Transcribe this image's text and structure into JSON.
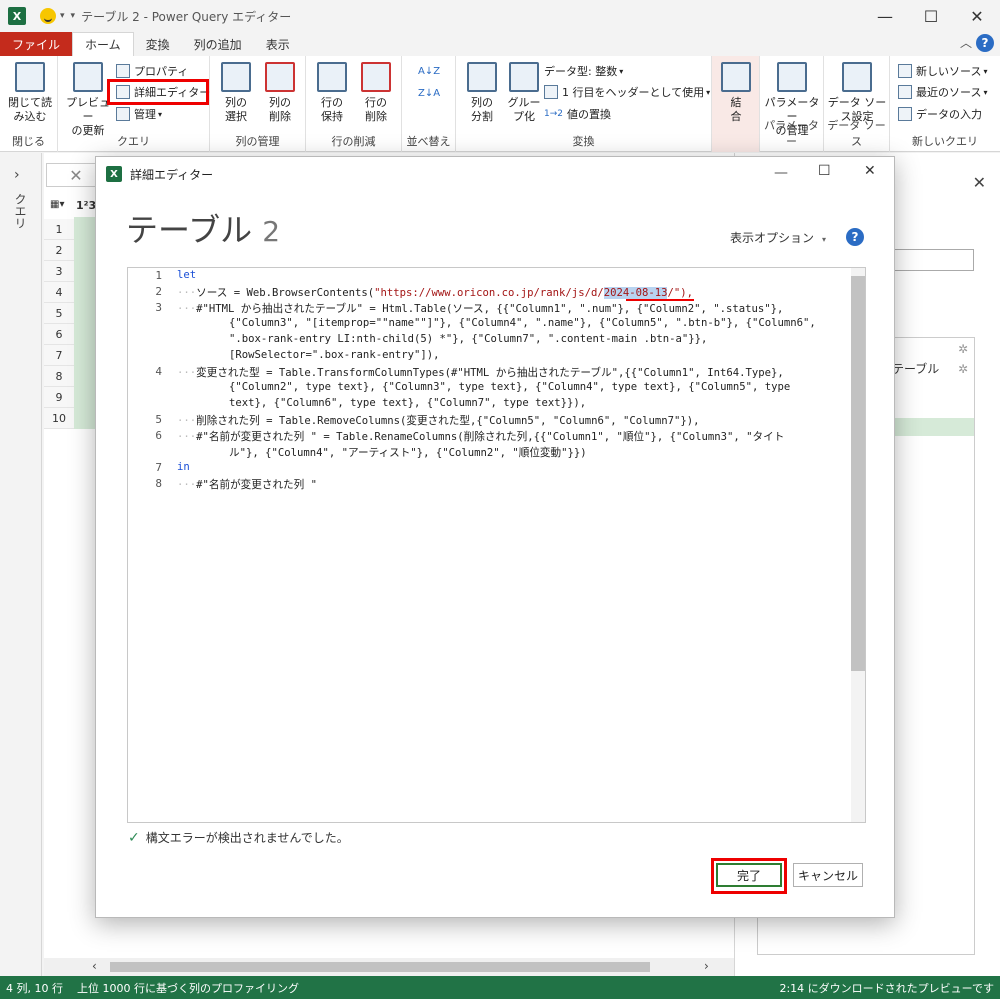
{
  "window": {
    "title": "テーブル 2 - Power Query エディター",
    "app_icon": "excel-icon"
  },
  "tabs": [
    "ファイル",
    "ホーム",
    "変換",
    "列の追加",
    "表示"
  ],
  "ribbon": {
    "close_group": {
      "btn": "閉じて読\nみ込む",
      "label": "閉じる"
    },
    "query_group": {
      "preview": "プレビュー\nの更新",
      "properties": "プロパティ",
      "advanced_editor": "詳細エディター",
      "manage": "管理",
      "label": "クエリ"
    },
    "columns_group": {
      "select": "列の\n選択",
      "remove": "列の\n削除",
      "label": "列の管理"
    },
    "rows_group": {
      "keep": "行の\n保持",
      "remove": "行の\n削除",
      "label": "行の削減"
    },
    "sort_group": {
      "label": "並べ替え"
    },
    "transform_group": {
      "split": "列の\n分割",
      "group": "グルー\nプ化",
      "datatype": "データ型: 整数",
      "header": "1 行目をヘッダーとして使用",
      "replace": "値の置換",
      "label": "変換"
    },
    "combine_group": {
      "btn": "結\n合",
      "label": ""
    },
    "param_group": {
      "btn": "パラメーター\nの管理",
      "label": "パラメーター"
    },
    "source_group": {
      "btn": "データ ソー\nス設定",
      "label": "データ ソース"
    },
    "newquery_group": {
      "new_source": "新しいソース",
      "recent": "最近のソース",
      "enter": "データの入力",
      "label": "新しいクエリ"
    }
  },
  "left_pane": {
    "label": "クエリ"
  },
  "grid": {
    "rows": [
      "1",
      "2",
      "3",
      "4",
      "5",
      "6",
      "7",
      "8",
      "9",
      "10"
    ],
    "col_type": "1²3"
  },
  "right_pane": {
    "step_fragment": "テーブル"
  },
  "dialog": {
    "title": "詳細エディター",
    "heading": "テーブル",
    "heading_num": "2",
    "display_options": "表示オプション",
    "syntax_ok": "構文エラーが検出されませんでした。",
    "ok": "完了",
    "cancel": "キャンセル"
  },
  "code": {
    "line_numbers": [
      "1",
      "2",
      "3",
      "",
      "",
      "",
      "4",
      "",
      "",
      "5",
      "6",
      "",
      "7",
      "8"
    ],
    "l1": "let",
    "l2a": "ソース = Web.BrowserContents(",
    "l2b": "\"https://www.oricon.co.jp/rank/js/d/",
    "l2sel": "2024-08-13",
    "l2c": "/\"),",
    "l3a": "#\"HTML から抽出されたテーブル\" = Html.Table(ソース, {{\"Column1\", \".num\"}, {\"Column2\", \".status\"},",
    "l3b": "{\"Column3\", \"[itemprop=\"\"name\"\"]\"}, {\"Column4\", \".name\"}, {\"Column5\", \".btn-b\"}, {\"Column6\",",
    "l3c": "\".box-rank-entry LI:nth-child(5) *\"}, {\"Column7\", \".content-main .btn-a\"}},",
    "l3d": "[RowSelector=\".box-rank-entry\"]),",
    "l4a": "変更された型 = Table.TransformColumnTypes(#\"HTML から抽出されたテーブル\",{{\"Column1\", Int64.Type},",
    "l4b": "{\"Column2\", type text}, {\"Column3\", type text}, {\"Column4\", type text}, {\"Column5\", type",
    "l4c": "text}, {\"Column6\", type text}, {\"Column7\", type text}}),",
    "l5": "削除された列 = Table.RemoveColumns(変更された型,{\"Column5\", \"Column6\", \"Column7\"}),",
    "l6a": "#\"名前が変更された列 \" = Table.RenameColumns(削除された列,{{\"Column1\", \"順位\"}, {\"Column3\", \"タイト",
    "l6b": "ル\"}, {\"Column4\", \"アーティスト\"}, {\"Column2\", \"順位変動\"}})",
    "l7": "in",
    "l8": "#\"名前が変更された列 \""
  },
  "status": {
    "left": "4 列, 10 行",
    "middle": "上位 1000 行に基づく列のプロファイリング",
    "right": "2:14 にダウンロードされたプレビューです"
  },
  "colors": {
    "excel_green": "#217346",
    "file_red": "#c42b1c",
    "highlight_red": "#e00000",
    "keyword_blue": "#1a4fd6"
  }
}
